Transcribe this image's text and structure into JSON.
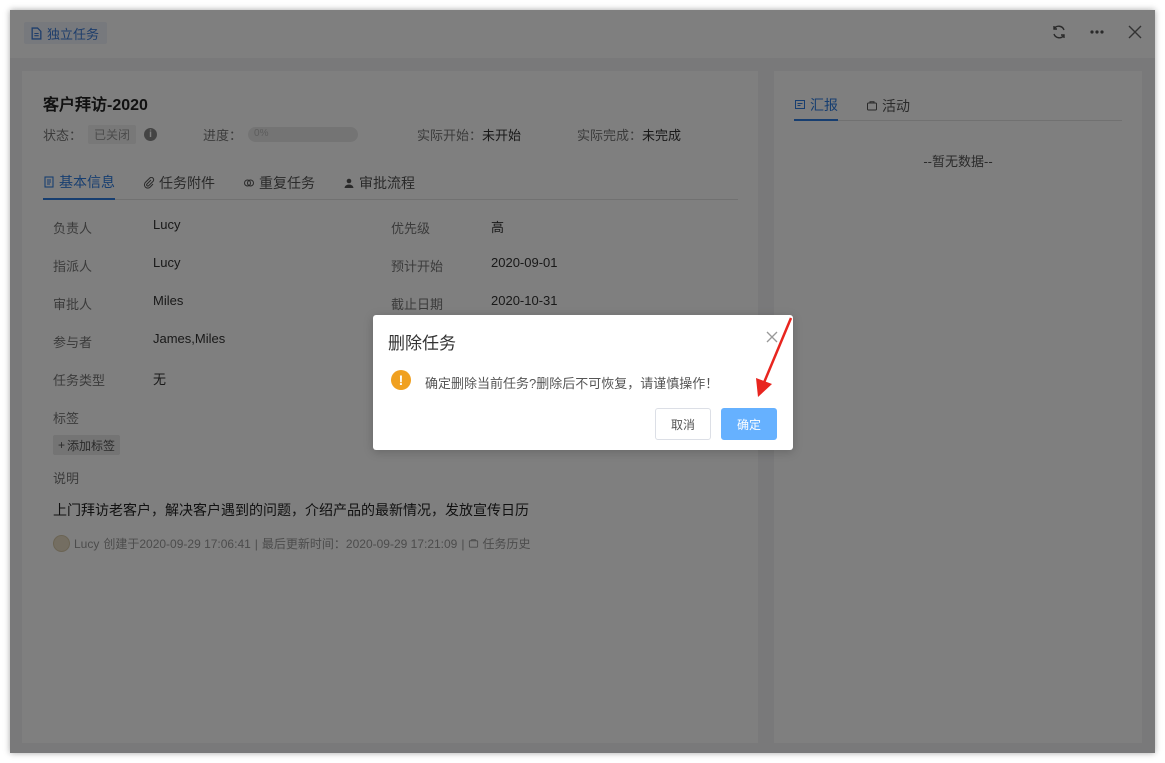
{
  "window": {
    "badge_label": "独立任务"
  },
  "task": {
    "title": "客户拜访-2020",
    "status_label": "状态：",
    "status_value": "已关闭",
    "progress_label": "进度：",
    "progress_value": "0%",
    "actual_start_label": "实际开始：",
    "actual_start_value": "未开始",
    "actual_end_label": "实际完成：",
    "actual_end_value": "未完成"
  },
  "tabs": [
    {
      "label": "基本信息",
      "icon": "document-icon"
    },
    {
      "label": "任务附件",
      "icon": "paperclip-icon"
    },
    {
      "label": "重复任务",
      "icon": "repeat-icon"
    },
    {
      "label": "审批流程",
      "icon": "person-icon"
    }
  ],
  "fields": {
    "owner_label": "负责人",
    "owner_value": "Lucy",
    "assigner_label": "指派人",
    "assigner_value": "Lucy",
    "approver_label": "审批人",
    "approver_value": "Miles",
    "participants_label": "参与者",
    "participants_value": "James,Miles",
    "type_label": "任务类型",
    "type_value": "无",
    "priority_label": "优先级",
    "priority_value": "高",
    "planned_start_label": "预计开始",
    "planned_start_value": "2020-09-01",
    "deadline_label": "截止日期",
    "deadline_value": "2020-10-31",
    "tags_label": "标签",
    "add_tag_label": "添加标签",
    "desc_label": "说明",
    "desc_value": "上门拜访老客户，解决客户遇到的问题，介绍产品的最新情况，发放宣传日历"
  },
  "footer": {
    "user": "Lucy",
    "created": "创建于2020-09-29 17:06:41",
    "sep1": "|",
    "updated": "最后更新时间：2020-09-29 17:21:09",
    "sep2": "|",
    "history": "任务历史"
  },
  "right_panel": {
    "tabs": [
      {
        "label": "汇报",
        "icon": "report-icon"
      },
      {
        "label": "活动",
        "icon": "activity-icon"
      }
    ],
    "empty_text": "--暂无数据--"
  },
  "dialog": {
    "title": "删除任务",
    "message": "确定删除当前任务?删除后不可恢复，请谨慎操作！",
    "cancel_label": "取消",
    "confirm_label": "确定"
  },
  "colors": {
    "accent": "#2e7de1",
    "confirm_button": "#66b1ff",
    "warning": "#f0a020",
    "annotation_arrow": "#e8251f"
  }
}
